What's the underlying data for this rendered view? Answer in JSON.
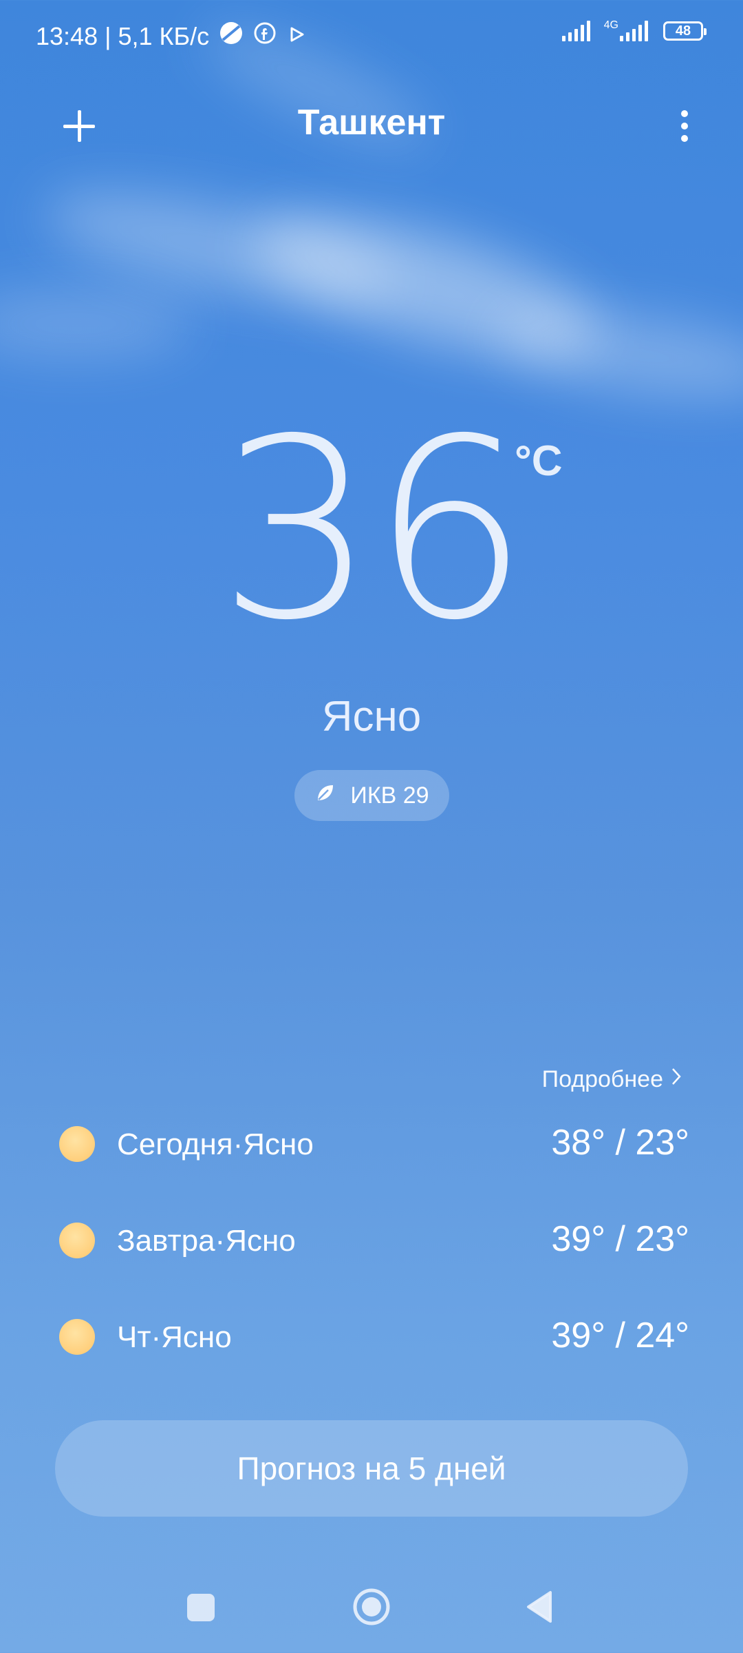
{
  "status_bar": {
    "time": "13:48",
    "net_speed": " | 5,1 КБ/с",
    "network_type": "4G",
    "battery": "48",
    "icons": [
      "vpn-icon",
      "facebook-icon",
      "play-store-icon",
      "signal-icon",
      "signal-4g-icon",
      "battery-icon"
    ]
  },
  "header": {
    "city": "Ташкент",
    "add_icon": "plus-icon",
    "menu_icon": "more-vertical-icon"
  },
  "current": {
    "temperature": "36",
    "unit": "°C",
    "condition": "Ясно",
    "aqi_label": "ИКВ 29",
    "aqi_icon": "leaf-icon"
  },
  "forecast": {
    "more_label": "Подробнее",
    "days": [
      {
        "label": "Сегодня·Ясно",
        "range": "38° / 23°",
        "icon": "sun-icon"
      },
      {
        "label": "Завтра·Ясно",
        "range": "39° / 23°",
        "icon": "sun-icon"
      },
      {
        "label": "Чт·Ясно",
        "range": "39° / 24°",
        "icon": "sun-icon"
      }
    ],
    "button_label": "Прогноз на 5 дней"
  },
  "nav": {
    "recents_icon": "square-icon",
    "home_icon": "circle-home-icon",
    "back_icon": "triangle-back-icon"
  },
  "colors": {
    "sky_top": "#3f86dc",
    "sky_bottom": "#74aae6",
    "sun": "#ffc76c"
  }
}
